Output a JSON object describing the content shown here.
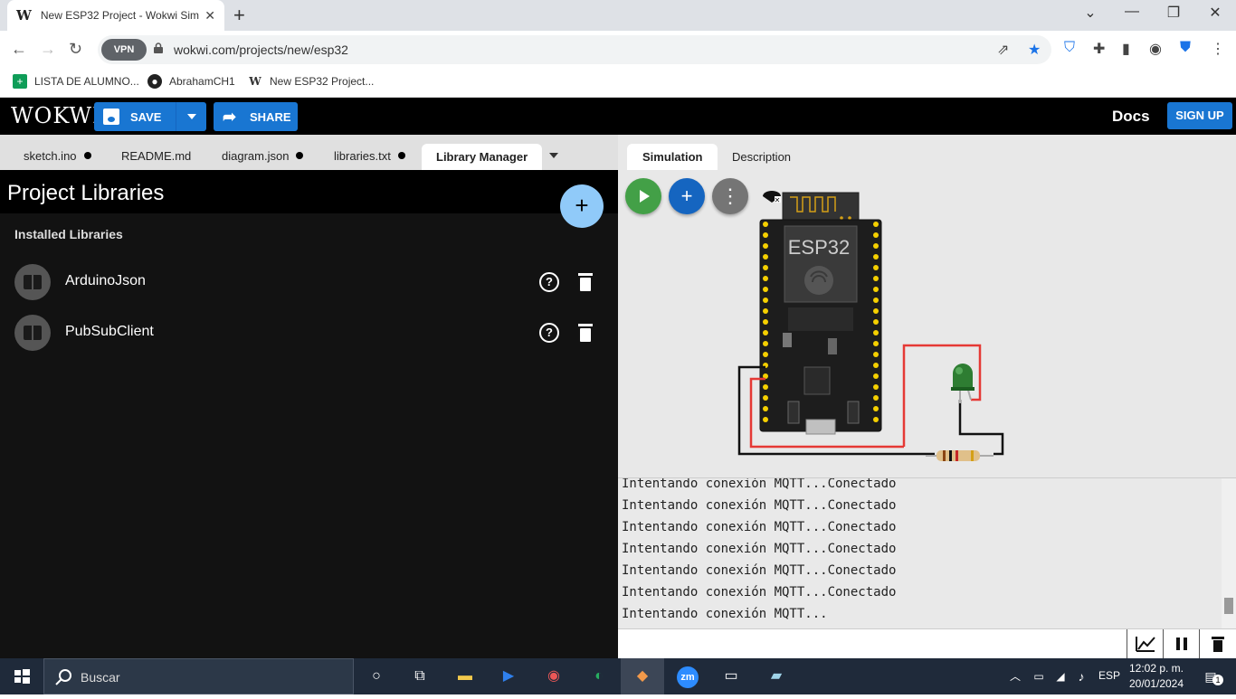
{
  "browser": {
    "tab_title": "New ESP32 Project - Wokwi Sim",
    "url": "wokwi.com/projects/new/esp32",
    "vpn_label": "VPN",
    "bookmarks": [
      {
        "label": "LISTA DE ALUMNO...",
        "icon": "sheets-icon"
      },
      {
        "label": "AbrahamCH1",
        "icon": "github-icon"
      },
      {
        "label": "New ESP32 Project...",
        "icon": "wokwi-icon"
      }
    ]
  },
  "header": {
    "logo": "WOKWI",
    "save_label": "SAVE",
    "share_label": "SHARE",
    "docs_label": "Docs",
    "signup_label": "SIGN UP"
  },
  "editor": {
    "tabs": [
      {
        "label": "sketch.ino",
        "modified": true
      },
      {
        "label": "README.md",
        "modified": false
      },
      {
        "label": "diagram.json",
        "modified": true
      },
      {
        "label": "libraries.txt",
        "modified": true
      },
      {
        "label": "Library Manager",
        "modified": false
      }
    ]
  },
  "libraries": {
    "title": "Project Libraries",
    "section_label": "Installed Libraries",
    "items": [
      {
        "name": "ArduinoJson"
      },
      {
        "name": "PubSubClient"
      }
    ]
  },
  "simulation": {
    "tabs": [
      "Simulation",
      "Description"
    ],
    "board_label": "ESP32"
  },
  "serial": {
    "lines": [
      "Intentando conexión MQTT...Conectado",
      "Intentando conexión MQTT...Conectado",
      "Intentando conexión MQTT...Conectado",
      "Intentando conexión MQTT...Conectado",
      "Intentando conexión MQTT...Conectado",
      "Intentando conexión MQTT...Conectado",
      "Intentando conexión MQTT..."
    ]
  },
  "taskbar": {
    "search_label": "Buscar",
    "lang": "ESP",
    "time": "12:02 p. m.",
    "date": "20/01/2024",
    "notifications": "1"
  },
  "colors": {
    "accent": "#1976d2",
    "fab_add": "#90caf9",
    "play_green": "#43a047",
    "wire_red": "#e53935"
  }
}
